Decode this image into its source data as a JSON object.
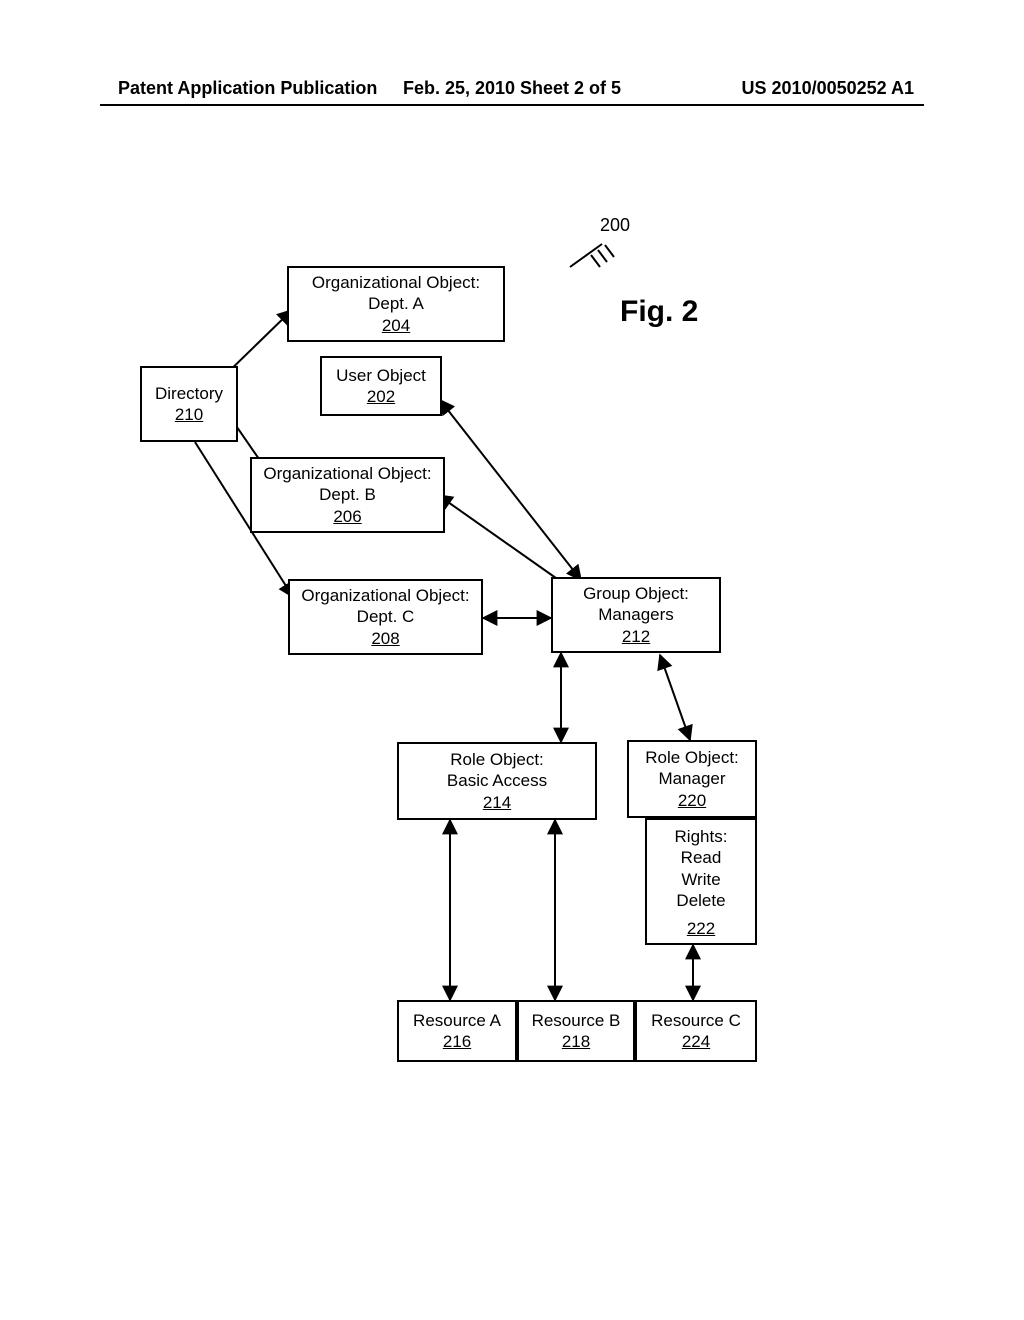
{
  "header": {
    "left": "Patent Application Publication",
    "center": "Feb. 25, 2010  Sheet 2 of 5",
    "right": "US 2010/0050252 A1"
  },
  "figure": {
    "title": "Fig. 2",
    "ref200": "200"
  },
  "boxes": {
    "directory": {
      "label": "Directory",
      "ref": "210"
    },
    "deptA": {
      "line1": "Organizational Object:",
      "line2": "Dept. A",
      "ref": "204"
    },
    "userObject": {
      "line1": "User Object",
      "ref": "202"
    },
    "deptB": {
      "line1": "Organizational Object:",
      "line2": "Dept. B",
      "ref": "206"
    },
    "deptC": {
      "line1": "Organizational Object:",
      "line2": "Dept. C",
      "ref": "208"
    },
    "groupManagers": {
      "line1": "Group Object:",
      "line2": "Managers",
      "ref": "212"
    },
    "roleBasic": {
      "line1": "Role Object:",
      "line2": "Basic Access",
      "ref": "214"
    },
    "roleManager": {
      "line1": "Role Object:",
      "line2": "Manager",
      "ref": "220"
    },
    "rights": {
      "header": "Rights:",
      "r1": "Read",
      "r2": "Write",
      "r3": "Delete",
      "ref": "222"
    },
    "resA": {
      "label": "Resource A",
      "ref": "216"
    },
    "resB": {
      "label": "Resource B",
      "ref": "218"
    },
    "resC": {
      "label": "Resource C",
      "ref": "224"
    }
  }
}
